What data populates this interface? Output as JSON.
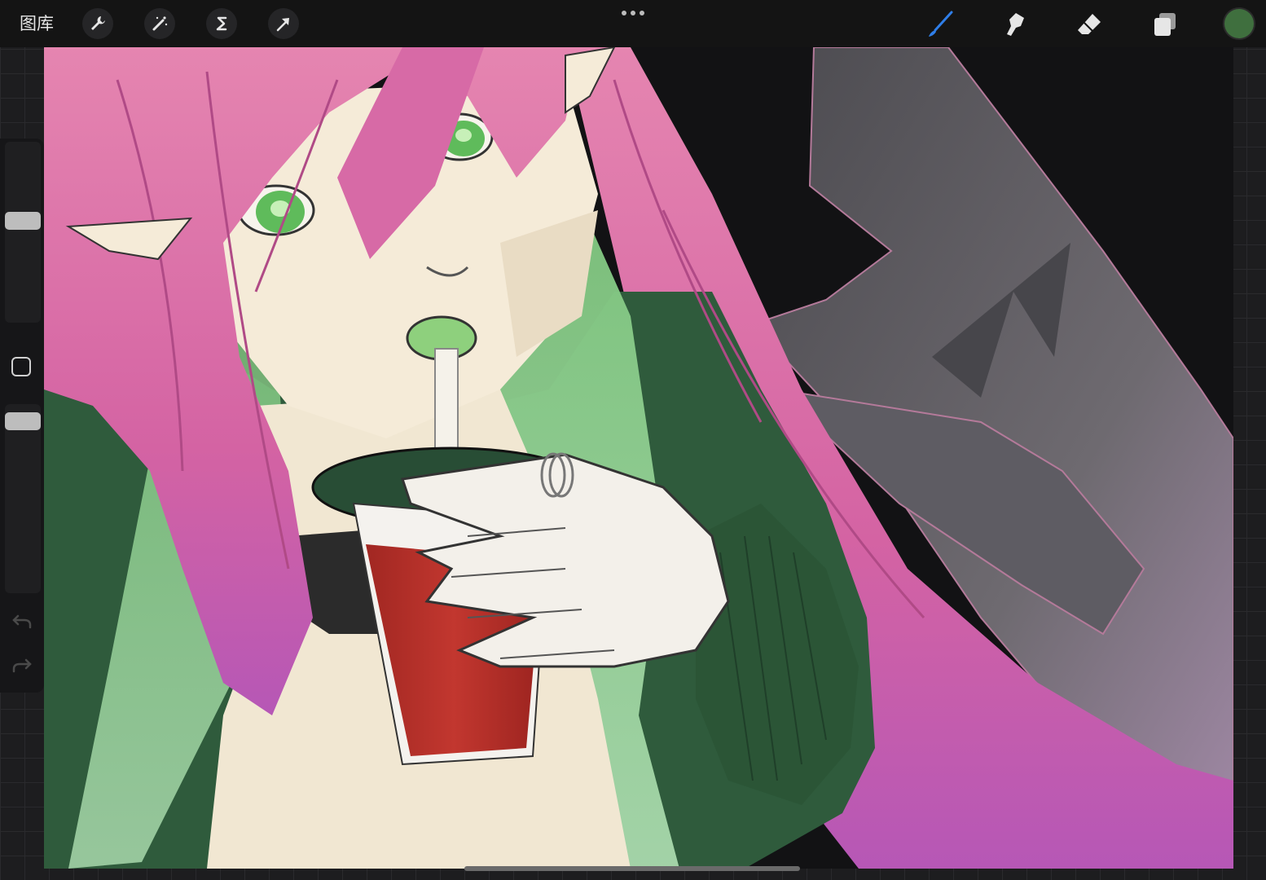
{
  "toolbar": {
    "gallery_label": "图库",
    "left_tools": [
      {
        "icon": "wrench-icon",
        "name": "actions"
      },
      {
        "icon": "magic-wand-icon",
        "name": "adjustments"
      },
      {
        "icon": "selection-s-icon",
        "name": "selection"
      },
      {
        "icon": "arrow-cursor-icon",
        "name": "transform"
      }
    ],
    "right_tools": [
      {
        "icon": "brush-icon",
        "name": "paint",
        "active": true
      },
      {
        "icon": "smudge-icon",
        "name": "smudge"
      },
      {
        "icon": "eraser-icon",
        "name": "eraser"
      },
      {
        "icon": "layers-icon",
        "name": "layers"
      }
    ],
    "current_color": "#3f6f3e",
    "active_color": "#2f7ee8"
  },
  "sidebar": {
    "size_slider_value": 0.55,
    "opacity_slider_value": 0.95,
    "icons": [
      "modify-square-icon",
      "undo-icon",
      "redo-icon"
    ]
  },
  "colors": {
    "canvas_bg": "#111111",
    "hair_pink": "#d86fa0",
    "hair_green": "#8fd08c",
    "jacket_green": "#2e5b3b",
    "cup_red": "#b5312a",
    "skin": "#f4ead7",
    "wings_gray": "#5c5b61"
  }
}
